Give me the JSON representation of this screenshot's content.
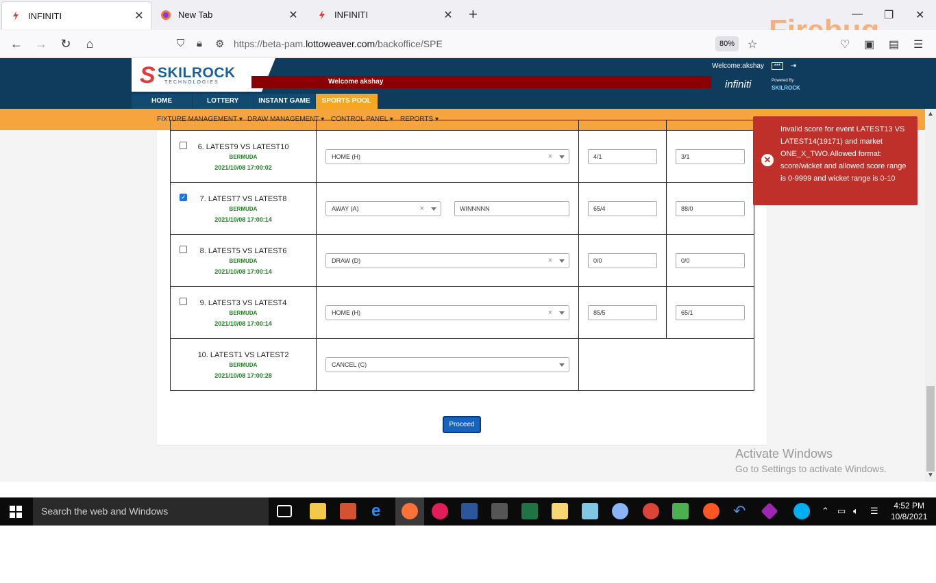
{
  "browser": {
    "tabs": [
      {
        "label": "INFINITI",
        "active": true
      },
      {
        "label": "New Tab",
        "active": false
      },
      {
        "label": "INFINITI",
        "active": false
      }
    ],
    "url_prefix": "https://beta-pam.",
    "url_host": "lottoweaver.com",
    "url_path": "/backoffice/SPE",
    "zoom": "80%",
    "watermark": "Firebug"
  },
  "header": {
    "logo_main": "SKILROCK",
    "logo_sub": "TECHNOLOGIES",
    "welcome_banner": "Welcome akshay",
    "welcome_user": "Welcome:akshay",
    "brand": "infiniti",
    "powered_by": "Powered By",
    "powered_brand": "SKILROCK",
    "main_nav": [
      "HOME",
      "LOTTERY",
      "INSTANT GAME",
      "SPORTS POOL"
    ],
    "active_nav": "SPORTS POOL"
  },
  "subnav": [
    "FIXTURE MANAGEMENT",
    "DRAW MANAGEMENT",
    "CONTROL PANEL",
    "REPORTS"
  ],
  "fixtures": [
    {
      "name": "6. LATEST9 VS LATEST10",
      "venue": "BERMUDA",
      "date": "2021/10/08 17:00:02",
      "checked": false,
      "result": "HOME (H)",
      "extra": "",
      "score1": "4/1",
      "score2": "3/1"
    },
    {
      "name": "7. LATEST7 VS LATEST8",
      "venue": "BERMUDA",
      "date": "2021/10/08 17:00:14",
      "checked": true,
      "result": "AWAY (A)",
      "extra": "WINNNNN",
      "score1": "65/4",
      "score2": "88/0"
    },
    {
      "name": "8. LATEST5 VS LATEST6",
      "venue": "BERMUDA",
      "date": "2021/10/08 17:00:14",
      "checked": false,
      "result": "DRAW (D)",
      "extra": "",
      "score1": "0/0",
      "score2": "0/0"
    },
    {
      "name": "9. LATEST3 VS LATEST4",
      "venue": "BERMUDA",
      "date": "2021/10/08 17:00:14",
      "checked": false,
      "result": "HOME (H)",
      "extra": "",
      "score1": "85/5",
      "score2": "65/1"
    },
    {
      "name": "10. LATEST1 VS LATEST2",
      "venue": "BERMUDA",
      "date": "2021/10/08 17:00:28",
      "checked": null,
      "result": "CANCEL (C)",
      "extra": "",
      "score1": "",
      "score2": ""
    }
  ],
  "proceed_label": "Proceed",
  "toast": {
    "message": "Invalid score for event LATEST13 VS LATEST14(19171) and market ONE_X_TWO.Allowed format: score/wicket and allowed score range is 0-9999 and wicket range is 0-10"
  },
  "activation": {
    "title": "Activate Windows",
    "subtitle": "Go to Settings to activate Windows."
  },
  "taskbar": {
    "search_placeholder": "Search the web and Windows",
    "time": "4:52 PM",
    "date": "10/8/2021"
  },
  "colors": {
    "header_bg": "#0f3b5c",
    "subnav_bg": "#f5a53c",
    "toast_bg": "#c0302b",
    "welcome_bg": "#8b0000",
    "proceed_bg": "#1565c0"
  }
}
